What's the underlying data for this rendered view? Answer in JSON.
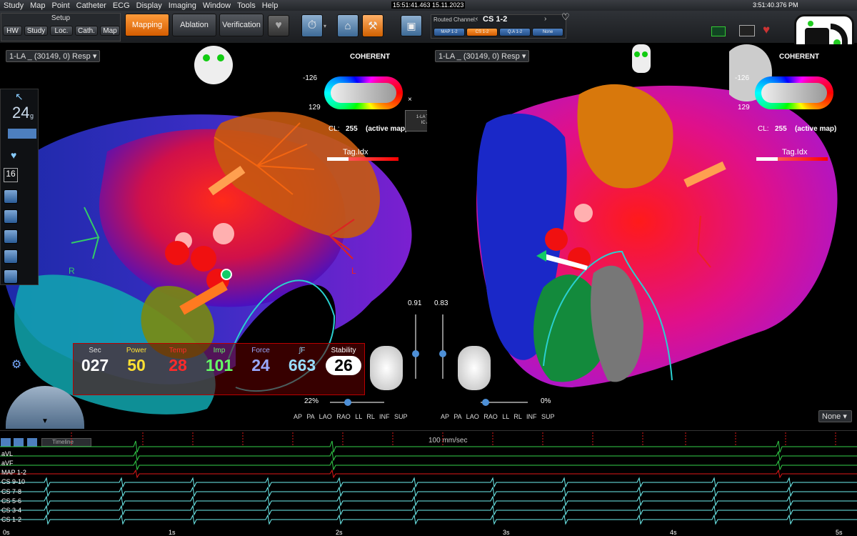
{
  "menu": [
    "Study",
    "Map",
    "Point",
    "Catheter",
    "ECG",
    "Display",
    "Imaging",
    "Window",
    "Tools",
    "Help"
  ],
  "clock_center": "15:51:41.463 15.11.2023",
  "clock_right": "3:51:40.376 PM",
  "setup": {
    "title": "Setup",
    "buttons": [
      "HW",
      "Study",
      "Loc.",
      "Cath.",
      "Map"
    ]
  },
  "modes": {
    "mapping": "Mapping",
    "ablation": "Ablation",
    "verification": "Verification"
  },
  "routed": {
    "title": "Routed Channel:",
    "channel": "CS 1-2",
    "chips": [
      "MAP 1-2",
      "CS 1-2",
      "Q.A 1-2",
      "None"
    ]
  },
  "left_view": {
    "selector": "1-LA _ (30149, 0) Resp",
    "coherent": "COHERENT",
    "range_top": "-126",
    "range_bottom": "129",
    "cl_label": "CL:",
    "cl_value": "255",
    "active_map": "(active map)",
    "tag": "Tag.Idx",
    "tcl_line1": "1-LA TCL 260 ms",
    "tcl_line2": "IC AFLU 1 4",
    "zoom_value": "0.91",
    "zoom_pct": "22%",
    "orient_r": "R",
    "orient_l": "L"
  },
  "right_view": {
    "selector": "1-LA _ (30149, 0) Resp",
    "coherent": "COHERENT",
    "range_top": "-126",
    "range_bottom": "129",
    "cl_label": "CL:",
    "cl_value": "255",
    "active_map": "(active map)",
    "tag": "Tag.Idx",
    "zoom_value": "0.83",
    "zoom_pct": "0%",
    "dropdown": "None"
  },
  "views": "AP PA LAO RAO LL RL INF SUP",
  "left_tools": {
    "weight": "24",
    "unit": "g",
    "count": "16"
  },
  "metrics": [
    {
      "label": "Sec",
      "value": "027",
      "color": "#ffffff"
    },
    {
      "label": "Power",
      "value": "50",
      "color": "#ffe033"
    },
    {
      "label": "Temp",
      "value": "28",
      "color": "#ff2a2a"
    },
    {
      "label": "Imp",
      "value": "101",
      "color": "#66ff66"
    },
    {
      "label": "Force",
      "value": "24",
      "color": "#99aaff"
    },
    {
      "label": "∫F",
      "value": "663",
      "color": "#99ddff"
    },
    {
      "label": "Stability",
      "value": "26",
      "color": "#000000"
    }
  ],
  "ecg": {
    "timeline": "Timeline",
    "speed": "100 mm/sec",
    "leads": [
      "aVL",
      "aVF",
      "MAP 1-2",
      "CS 9-10",
      "CS 7-8",
      "CS 5-6",
      "CS 3-4",
      "CS 1-2"
    ],
    "time_ticks": [
      "0s",
      "1s",
      "2s",
      "3s",
      "4s",
      "5s"
    ]
  },
  "colors": {
    "mapping_accent": "#f07a14",
    "ecg_green": "#33d04a",
    "ecg_red": "#e01818",
    "ecg_cyan": "#6ff0f0",
    "boundary_cyan": "#2ad0d0"
  }
}
